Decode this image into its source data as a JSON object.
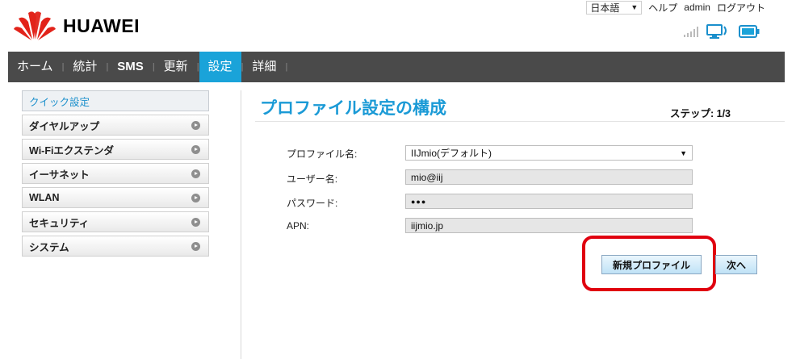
{
  "header": {
    "logo_text": "HUAWEI",
    "language": "日本語",
    "help": "ヘルプ",
    "user": "admin",
    "logout": "ログアウト",
    "icons": [
      "signal-icon",
      "pc-connection-icon",
      "battery-icon"
    ]
  },
  "nav": {
    "items": [
      {
        "label": "ホーム"
      },
      {
        "label": "統計"
      },
      {
        "label": "SMS"
      },
      {
        "label": "更新"
      },
      {
        "label": "設定"
      },
      {
        "label": "詳細"
      }
    ],
    "active": "設定"
  },
  "sidebar": {
    "items": [
      {
        "label": "クイック設定"
      },
      {
        "label": "ダイヤルアップ"
      },
      {
        "label": "Wi-Fiエクステンダ"
      },
      {
        "label": "イーサネット"
      },
      {
        "label": "WLAN"
      },
      {
        "label": "セキュリティ"
      },
      {
        "label": "システム"
      }
    ]
  },
  "main": {
    "title": "プロファイル設定の構成",
    "step": "ステップ: 1/3",
    "form": {
      "profile_label": "プロファイル名:",
      "profile_value": "IIJmio(デフォルト)",
      "user_label": "ユーザー名:",
      "user_value": "mio@iij",
      "password_label": "パスワード:",
      "password_value": "●●●",
      "apn_label": "APN:",
      "apn_value": "iijmio.jp"
    },
    "new_profile_button": "新規プロファイル",
    "next_button": "次へ"
  },
  "colors": {
    "accent": "#1aa3d9",
    "nav_bg": "#4a4a4a",
    "highlight": "#e0000f"
  }
}
